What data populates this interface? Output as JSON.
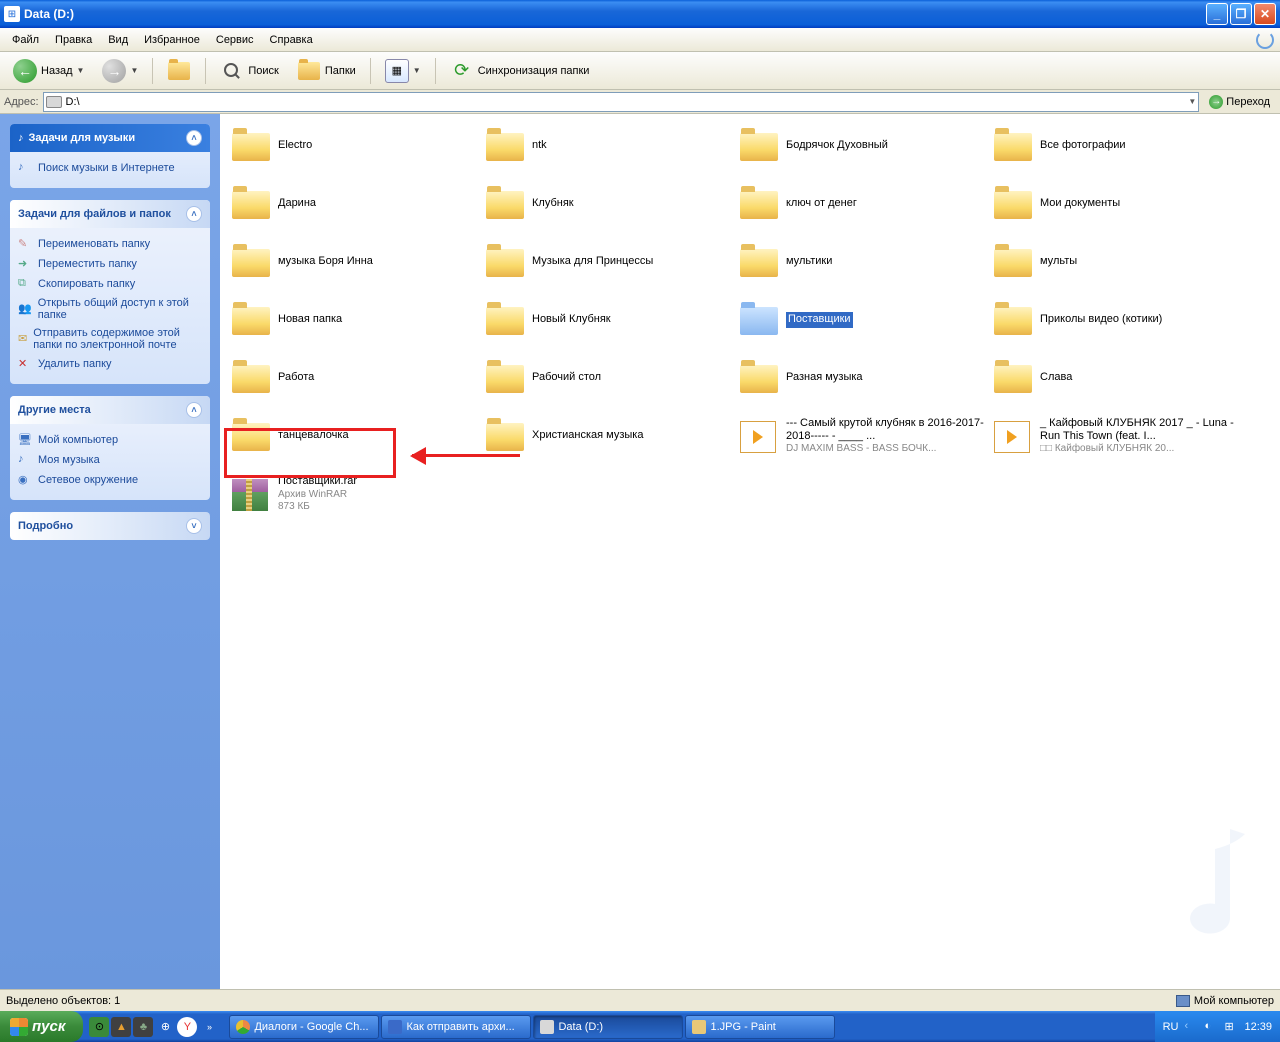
{
  "window": {
    "title": "Data (D:)"
  },
  "menu": {
    "file": "Файл",
    "edit": "Правка",
    "view": "Вид",
    "favorites": "Избранное",
    "tools": "Сервис",
    "help": "Справка"
  },
  "toolbar": {
    "back": "Назад",
    "search": "Поиск",
    "folders": "Папки",
    "sync": "Синхронизация папки"
  },
  "address": {
    "label": "Адрес:",
    "value": "D:\\",
    "go": "Переход"
  },
  "side": {
    "music": {
      "title": "Задачи для музыки",
      "search": "Поиск музыки в Интернете"
    },
    "tasks": {
      "title": "Задачи для файлов и папок",
      "rename": "Переименовать папку",
      "move": "Переместить папку",
      "copy": "Скопировать папку",
      "share": "Открыть общий доступ к этой папке",
      "email": "Отправить содержимое этой папки по электронной почте",
      "delete": "Удалить папку"
    },
    "places": {
      "title": "Другие места",
      "mycomp": "Мой компьютер",
      "mymusic": "Моя музыка",
      "network": "Сетевое окружение"
    },
    "details": {
      "title": "Подробно"
    }
  },
  "files": {
    "folders": [
      "Electro",
      "ntk",
      "Бодрячок Духовный",
      "Все фотографии",
      "Дарина",
      "Клубняк",
      "ключ от денег",
      "Мои документы",
      "музыка Боря Инна",
      "Музыка для Принцессы",
      "мультики",
      "мульты",
      "Новая папка",
      "Новый Клубняк",
      "Поставщики",
      "Приколы видео (котики)",
      "Работа",
      "Рабочий стол",
      "Разная музыка",
      "Слава",
      "танцевалочка",
      "Христианская музыка"
    ],
    "media1": {
      "l1": "--- Самый крутой клубняк в 2016-2017-2018----- - ____ ...",
      "l2": "DJ MAXIM BASS - BASS БОЧК..."
    },
    "media2": {
      "l1": "_ Кайфовый КЛУБНЯК 2017 _ - Luna - Run This Town (feat. I...",
      "l2": "□□ Кайфовый КЛУБНЯК 20..."
    },
    "rar": {
      "name": "Поставщики.rar",
      "type": "Архив WinRAR",
      "size": "873 КБ"
    }
  },
  "status": {
    "left": "Выделено объектов: 1",
    "right": "Мой компьютер"
  },
  "taskbar": {
    "start": "пуск",
    "tasks": [
      "Диалоги - Google Ch...",
      "Как отправить архи...",
      "Data (D:)",
      "1.JPG - Paint"
    ],
    "lang": "RU",
    "clock": "12:39"
  }
}
